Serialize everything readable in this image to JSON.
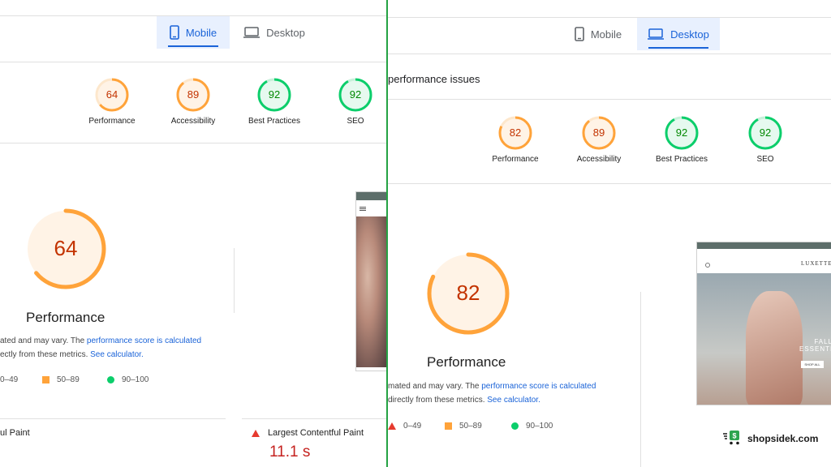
{
  "left": {
    "tabs": [
      {
        "label": "Mobile",
        "active": true
      },
      {
        "label": "Desktop",
        "active": false
      }
    ],
    "scores": [
      {
        "value": "64",
        "label": "Performance",
        "level": "average"
      },
      {
        "value": "89",
        "label": "Accessibility",
        "level": "average"
      },
      {
        "value": "92",
        "label": "Best Practices",
        "level": "pass"
      },
      {
        "value": "92",
        "label": "SEO",
        "level": "pass"
      }
    ],
    "big_score": "64",
    "big_title": "Performance",
    "desc_line1_prefix": "ated and may vary. The ",
    "desc_line1_link": "performance score is calculated",
    "desc_line2_prefix": "ectly from these metrics. ",
    "desc_line2_link": "See calculator.",
    "legend": [
      "0–49",
      "50–89",
      "90–100"
    ],
    "metric_left_label": "ul Paint",
    "metric_label": "Largest Contentful Paint",
    "metric_value": "11.1 s"
  },
  "right": {
    "tabs": [
      {
        "label": "Mobile",
        "active": false
      },
      {
        "label": "Desktop",
        "active": true
      }
    ],
    "section_title": "performance issues",
    "scores": [
      {
        "value": "82",
        "label": "Performance",
        "level": "average"
      },
      {
        "value": "89",
        "label": "Accessibility",
        "level": "average"
      },
      {
        "value": "92",
        "label": "Best Practices",
        "level": "pass"
      },
      {
        "value": "92",
        "label": "SEO",
        "level": "pass"
      }
    ],
    "big_score": "82",
    "big_title": "Performance",
    "desc_line1_prefix": "mated and may vary. The ",
    "desc_line1_link": "performance score is calculated",
    "desc_line2_prefix": "directly from these metrics. ",
    "desc_line2_link": "See calculator.",
    "legend": [
      "0–49",
      "50–89",
      "90–100"
    ],
    "thumb_text": {
      "store_name": "LUXETTE",
      "hero_title": "FALL",
      "hero_subtitle": "ESSENTIALS",
      "hero_button": "SHOP ALL"
    }
  },
  "watermark": "shopsidek.com",
  "colors": {
    "average_ring": "#ffa33a",
    "average_fill": "#fff3e6",
    "average_text": "#c33300",
    "pass_ring": "#0cce6b",
    "pass_fill": "#e6f9ef",
    "pass_text": "#008800",
    "accent_blue": "#1a63d8",
    "divider_green": "#25a243"
  }
}
